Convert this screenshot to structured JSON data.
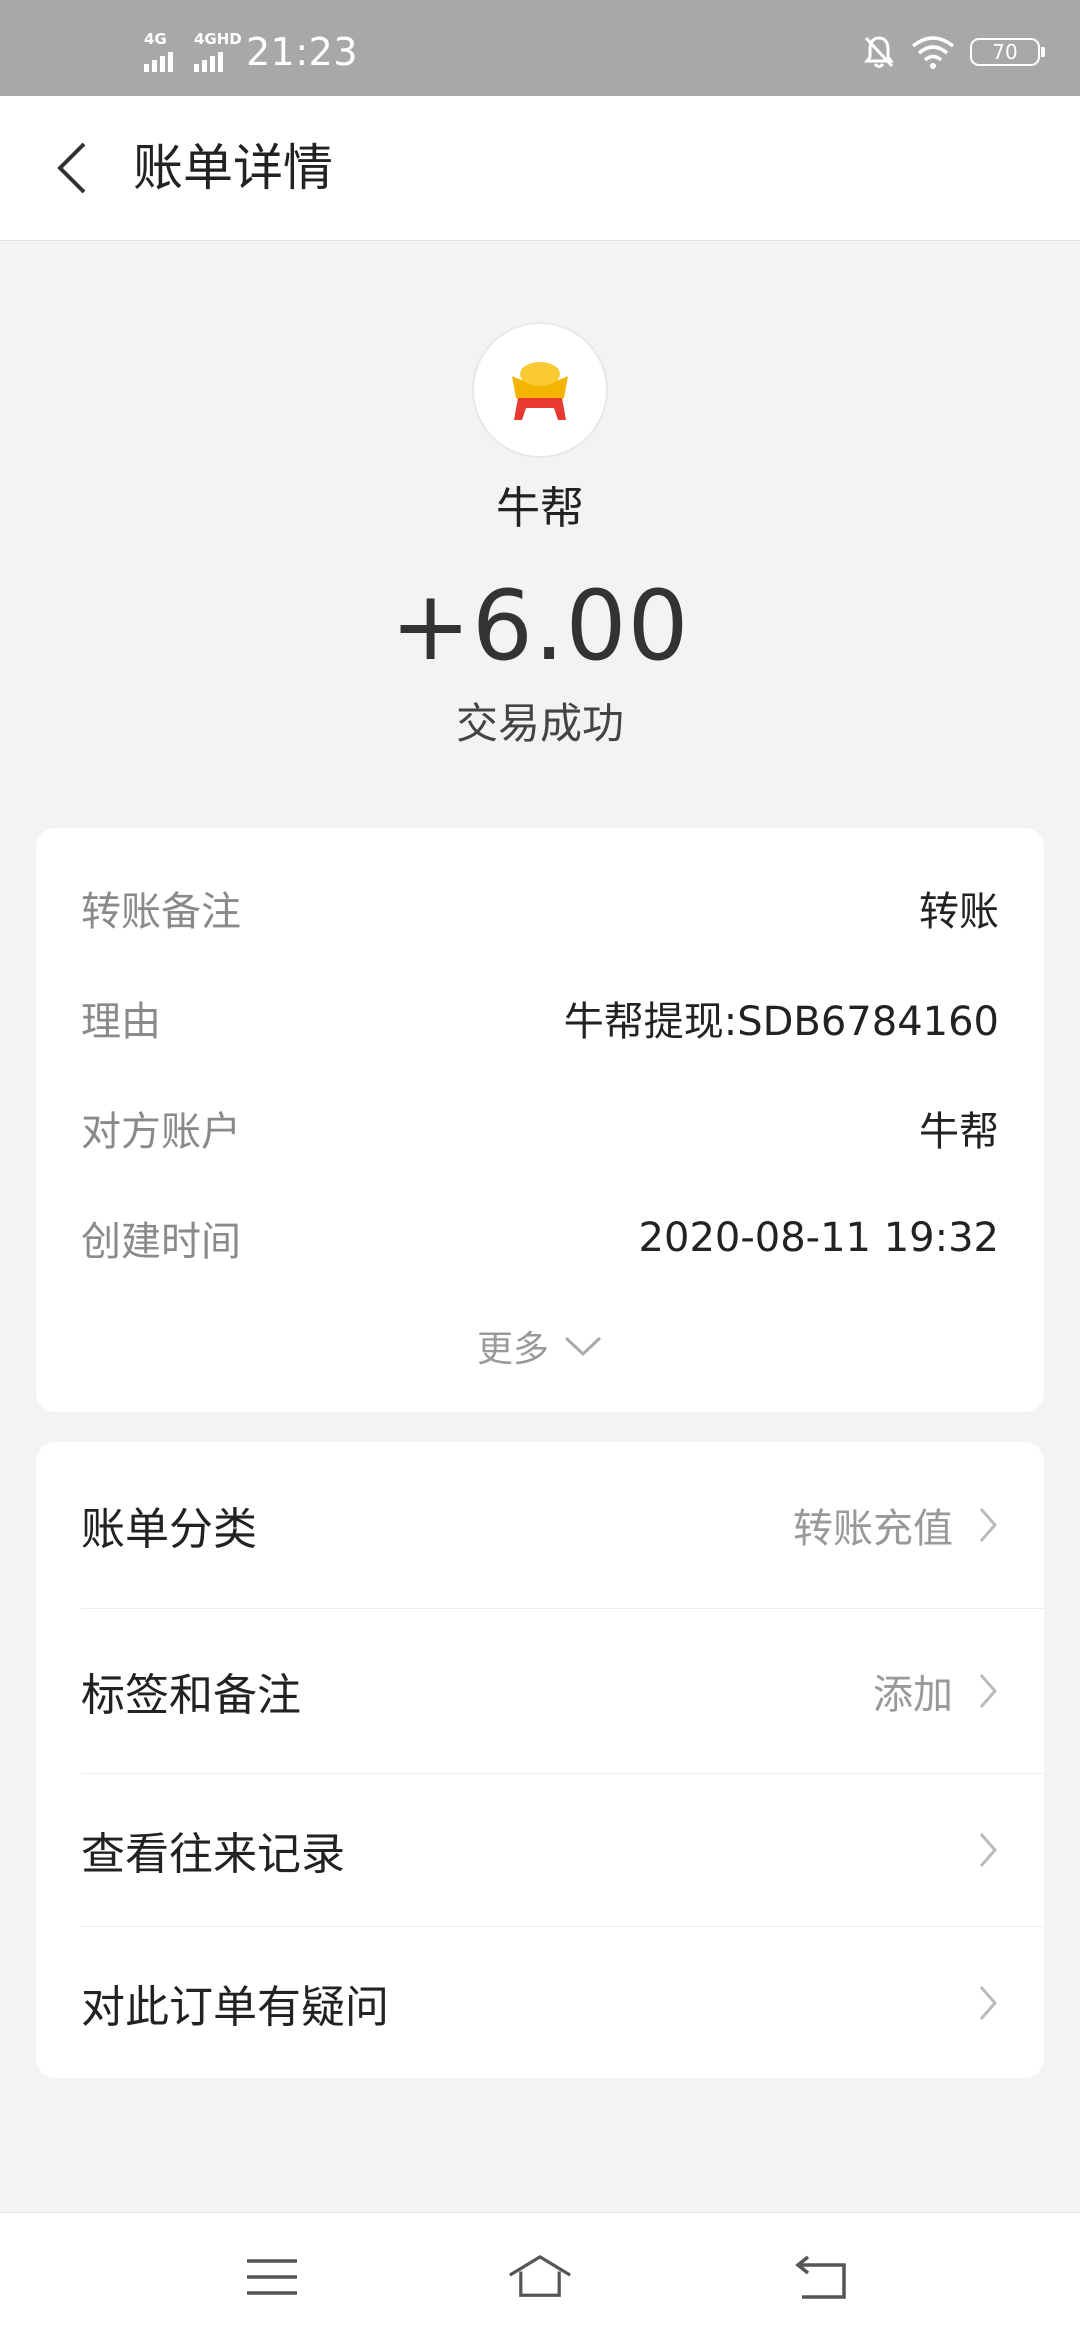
{
  "status_bar": {
    "signal1_label": "4G",
    "signal2_label": "4GHD",
    "time": "21:23",
    "battery": "70"
  },
  "header": {
    "title": "账单详情"
  },
  "merchant": {
    "name": "牛帮",
    "amount": "+6.00",
    "status": "交易成功"
  },
  "details": [
    {
      "label": "转账备注",
      "value": "转账"
    },
    {
      "label": "理由",
      "value": "牛帮提现:SDB6784160"
    },
    {
      "label": "对方账户",
      "value": "牛帮"
    },
    {
      "label": "创建时间",
      "value": "2020-08-11 19:32"
    }
  ],
  "more_label": "更多",
  "actions": [
    {
      "label": "账单分类",
      "value": "转账充值"
    },
    {
      "label": "标签和备注",
      "value": "添加"
    },
    {
      "label": "查看往来记录",
      "value": ""
    },
    {
      "label": "对此订单有疑问",
      "value": ""
    }
  ],
  "colors": {
    "status_bar": "#a8a8a8",
    "page_background": "#f3f3f3",
    "card_background": "#ffffff",
    "secondary_text": "#8a8a8a",
    "ingot_gold": "#f5b400",
    "ingot_red": "#e8382f"
  },
  "icons": {
    "back": "chevron-left-icon",
    "merchant": "gold-ingot-icon",
    "more": "chevron-down-icon",
    "row": "chevron-right-icon",
    "nav_menu": "menu-icon",
    "nav_home": "home-icon",
    "nav_back": "back-arrow-icon"
  }
}
